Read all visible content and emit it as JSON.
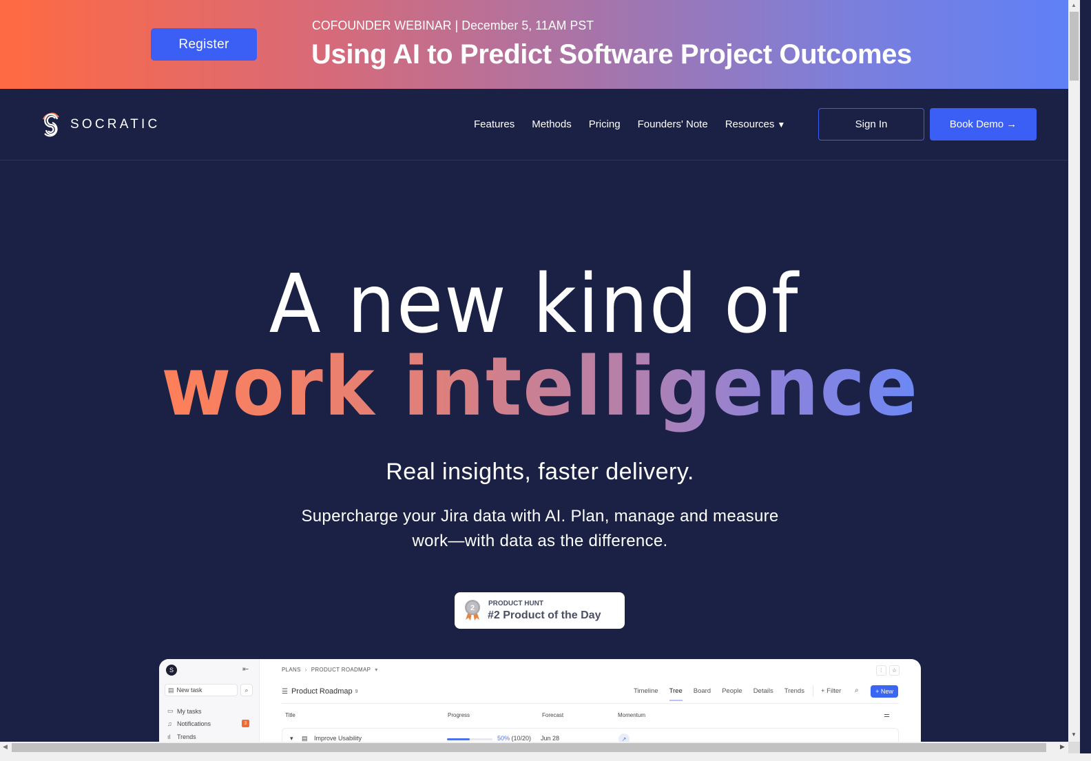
{
  "banner": {
    "register_label": "Register",
    "kicker": "COFOUNDER WEBINAR | December 5, 11AM PST",
    "title": "Using AI to Predict Software Project Outcomes"
  },
  "nav": {
    "brand": "SOCRATIC",
    "links": [
      "Features",
      "Methods",
      "Pricing",
      "Founders' Note",
      "Resources"
    ],
    "resources_caret": "▼",
    "sign_in": "Sign In",
    "book_demo": "Book Demo →"
  },
  "hero": {
    "line1": "A new kind of",
    "line2": "work intelligence",
    "tagline": "Real insights, faster delivery.",
    "subcopy": "Supercharge your Jira data with AI. Plan, manage and measure work—with data as the difference."
  },
  "badge": {
    "kicker": "PRODUCT HUNT",
    "title": "#2 Product of the Day",
    "medal_number": "2"
  },
  "app_preview": {
    "sidebar": {
      "avatar_letter": "S",
      "new_task": "New task",
      "items": [
        {
          "label": "My tasks",
          "icon": "tasks-icon"
        },
        {
          "label": "Notifications",
          "icon": "bell-icon",
          "badge": "3"
        },
        {
          "label": "Trends",
          "icon": "chart-icon"
        }
      ]
    },
    "breadcrumb": [
      "PLANS",
      "PRODUCT ROADMAP"
    ],
    "plan_title": "Product Roadmap",
    "plan_count": "9",
    "tabs": [
      "Timeline",
      "Tree",
      "Board",
      "People",
      "Details",
      "Trends"
    ],
    "active_tab": "Tree",
    "filter_label": "+ Filter",
    "new_label": "+ New",
    "columns": [
      "Title",
      "Progress",
      "Forecast",
      "Momentum"
    ],
    "rows": [
      {
        "title": "Improve Usability",
        "progress": 0.5,
        "progress_label": "50%",
        "progress_detail": "(10/20)",
        "forecast": "Jun 28",
        "momentum": "↗"
      }
    ]
  },
  "colors": {
    "page_bg": "#1b2145",
    "accent_blue": "#3b5ef5",
    "banner_start": "#ff6a42",
    "banner_end": "#5f80f7",
    "notification_badge": "#f06a35"
  }
}
